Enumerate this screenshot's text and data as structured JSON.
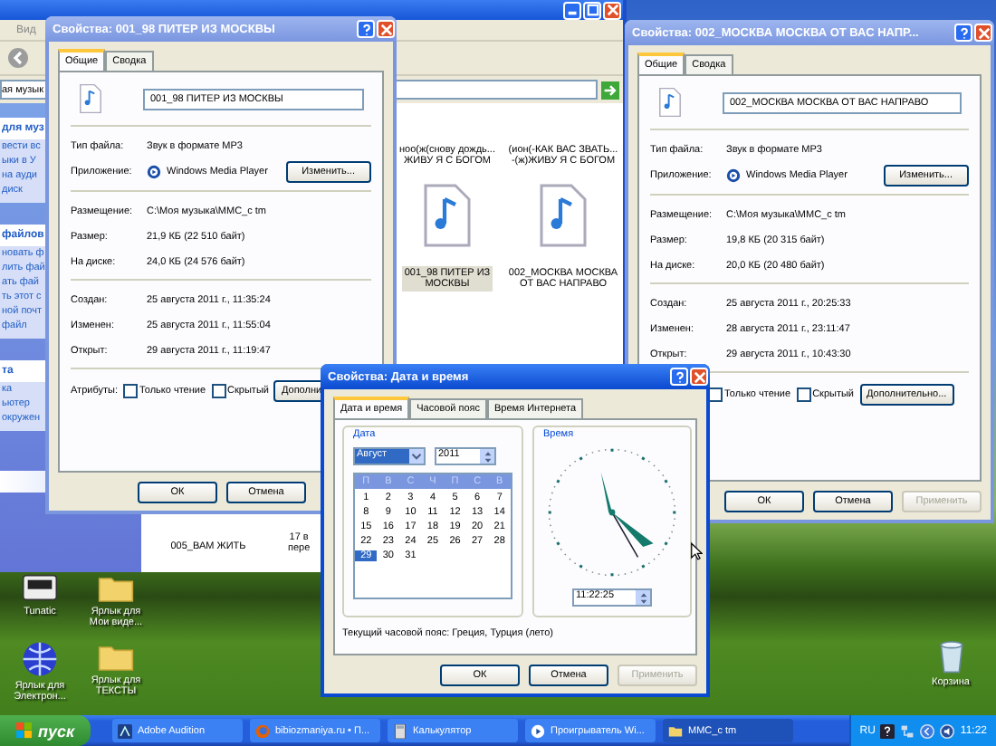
{
  "explorer": {
    "menu": [
      {
        "label": "Вид"
      }
    ],
    "address": "ая музык",
    "sidebar": [
      {
        "title": "для муз",
        "links": [
          "вести вс",
          "ыки в У",
          "на ауди",
          "диск"
        ]
      },
      {
        "title": "файлов",
        "links": [
          "новать ф",
          "лить фай",
          "ать фай",
          "ть этот с",
          "ной почт",
          "файл"
        ]
      },
      {
        "title": "та",
        "links": [
          "ка",
          "ьютер",
          "окружен"
        ]
      }
    ],
    "files": [
      {
        "lines": [
          "ноо(ж(снову дождь...",
          "ЖИВУ Я С БОГОМ"
        ],
        "selected": false
      },
      {
        "lines": [
          "(ион(-КАК ВАС ЗВАТЬ...",
          "-(ж)ЖИВУ Я С БОГОМ"
        ],
        "selected": false
      },
      {
        "lines": [
          "001_98 ПИТЕР ИЗ",
          "МОСКВЫ"
        ],
        "selected": true
      },
      {
        "lines": [
          "002_МОСКВА МОСКВА",
          "ОТ ВАС НАПРАВО"
        ],
        "selected": false
      },
      {
        "lines": [
          "005_ВАМ ЖИТЬ"
        ],
        "selected": false
      },
      {
        "lines": [
          "17 в",
          "пере"
        ],
        "selected": false
      }
    ]
  },
  "desktop_icons": [
    {
      "kind": "app",
      "lines": [
        "Tunatic"
      ]
    },
    {
      "kind": "folder",
      "lines": [
        "Ярлык для",
        "Мои виде..."
      ]
    },
    {
      "kind": "globe",
      "lines": [
        "Ярлык для",
        "Электрон..."
      ]
    },
    {
      "kind": "folder",
      "lines": [
        "Ярлык для",
        "ТЕКСТЫ"
      ]
    },
    {
      "kind": "bin",
      "lines": [
        "Корзина"
      ]
    }
  ],
  "dialogs": [
    {
      "title": "Свойства: 001_98 ПИТЕР ИЗ МОСКВЫ",
      "active": false,
      "tabs": [
        {
          "label": "Общие",
          "selected": true
        },
        {
          "label": "Сводка",
          "selected": false
        }
      ],
      "name": "001_98 ПИТЕР ИЗ МОСКВЫ",
      "sections": [
        [
          {
            "kind": "text",
            "label": "Тип файла:",
            "value": "Звук в формате MP3"
          },
          {
            "kind": "app",
            "label": "Приложение:",
            "value": "Windows Media Player",
            "button": "Изменить..."
          }
        ],
        [
          {
            "kind": "text",
            "label": "Размещение:",
            "value": "C:\\Моя музыка\\MMC_c tm"
          },
          {
            "kind": "text",
            "label": "Размер:",
            "value": "21,9 КБ (22 510 байт)"
          },
          {
            "kind": "text",
            "label": "На диске:",
            "value": "24,0 КБ (24 576 байт)"
          }
        ],
        [
          {
            "kind": "text",
            "label": "Создан:",
            "value": "25 августа 2011 г., 11:35:24"
          },
          {
            "kind": "text",
            "label": "Изменен:",
            "value": "25 августа 2011 г., 11:55:04"
          },
          {
            "kind": "text",
            "label": "Открыт:",
            "value": "29 августа 2011 г., 11:19:47"
          }
        ]
      ],
      "attributes": {
        "label": "Атрибуты:",
        "checkboxes": [
          {
            "label": "Только чтение",
            "checked": false
          },
          {
            "label": "Скрытый",
            "checked": false
          }
        ],
        "button": "Дополни"
      },
      "buttons": [
        {
          "label": "ОК",
          "disabled": false
        },
        {
          "label": "Отмена",
          "disabled": false
        }
      ]
    },
    {
      "title": "Свойства: 002_МОСКВА МОСКВА ОТ ВАС НАПР...",
      "active": false,
      "tabs": [
        {
          "label": "Общие",
          "selected": true
        },
        {
          "label": "Сводка",
          "selected": false
        }
      ],
      "name": "002_МОСКВА МОСКВА ОТ ВАС НАПРАВО",
      "sections": [
        [
          {
            "kind": "text",
            "label": "Тип файла:",
            "value": "Звук в формате MP3"
          },
          {
            "kind": "app",
            "label": "Приложение:",
            "value": "Windows Media Player",
            "button": "Изменить..."
          }
        ],
        [
          {
            "kind": "text",
            "label": "Размещение:",
            "value": "C:\\Моя музыка\\MMC_c tm"
          },
          {
            "kind": "text",
            "label": "Размер:",
            "value": "19,8 КБ (20 315 байт)"
          },
          {
            "kind": "text",
            "label": "На диске:",
            "value": "20,0 КБ (20 480 байт)"
          }
        ],
        [
          {
            "kind": "text",
            "label": "Создан:",
            "value": "25 августа 2011 г., 20:25:33"
          },
          {
            "kind": "text",
            "label": "Изменен:",
            "value": "28 августа 2011 г., 23:11:47"
          },
          {
            "kind": "text",
            "label": "Открыт:",
            "value": "29 августа 2011 г., 10:43:30"
          }
        ]
      ],
      "attributes": {
        "checkboxes": [
          {
            "label": "Только чтение",
            "checked": false
          },
          {
            "label": "Скрытый",
            "checked": false
          }
        ],
        "button": "Дополнительно..."
      },
      "buttons": [
        {
          "label": "ОК",
          "disabled": false
        },
        {
          "label": "Отмена",
          "disabled": false
        },
        {
          "label": "Применить",
          "disabled": true
        }
      ]
    }
  ],
  "date_dialog": {
    "title": "Свойства: Дата и время",
    "active": true,
    "tabs": [
      {
        "label": "Дата и время",
        "selected": true
      },
      {
        "label": "Часовой пояс",
        "selected": false
      },
      {
        "label": "Время Интернета",
        "selected": false
      }
    ],
    "date_group": "Дата",
    "month": "Август",
    "year": "2011",
    "weekdays": [
      "П",
      "В",
      "С",
      "Ч",
      "П",
      "С",
      "В"
    ],
    "days": [
      {
        "label": "1",
        "selected": false
      },
      {
        "label": "2",
        "selected": false
      },
      {
        "label": "3",
        "selected": false
      },
      {
        "label": "4",
        "selected": false
      },
      {
        "label": "5",
        "selected": false
      },
      {
        "label": "6",
        "selected": false
      },
      {
        "label": "7",
        "selected": false
      },
      {
        "label": "8",
        "selected": false
      },
      {
        "label": "9",
        "selected": false
      },
      {
        "label": "10",
        "selected": false
      },
      {
        "label": "11",
        "selected": false
      },
      {
        "label": "12",
        "selected": false
      },
      {
        "label": "13",
        "selected": false
      },
      {
        "label": "14",
        "selected": false
      },
      {
        "label": "15",
        "selected": false
      },
      {
        "label": "16",
        "selected": false
      },
      {
        "label": "17",
        "selected": false
      },
      {
        "label": "18",
        "selected": false
      },
      {
        "label": "19",
        "selected": false
      },
      {
        "label": "20",
        "selected": false
      },
      {
        "label": "21",
        "selected": false
      },
      {
        "label": "22",
        "selected": false
      },
      {
        "label": "23",
        "selected": false
      },
      {
        "label": "24",
        "selected": false
      },
      {
        "label": "25",
        "selected": false
      },
      {
        "label": "26",
        "selected": false
      },
      {
        "label": "27",
        "selected": false
      },
      {
        "label": "28",
        "selected": false
      },
      {
        "label": "29",
        "selected": true
      },
      {
        "label": "30",
        "selected": false
      },
      {
        "label": "31",
        "selected": false
      }
    ],
    "time_group": "Время",
    "time": "11:22:25",
    "timezone": "Текущий часовой пояс: Греция, Турция (лето)",
    "buttons": [
      {
        "label": "ОК",
        "disabled": false
      },
      {
        "label": "Отмена",
        "disabled": false
      },
      {
        "label": "Применить",
        "disabled": true
      }
    ]
  },
  "taskbar": {
    "start": "пуск",
    "items": [
      {
        "label": "Adobe Audition",
        "kind": "audio",
        "selected": false
      },
      {
        "label": "bibiozmaniya.ru • П...",
        "kind": "browser",
        "selected": false
      },
      {
        "label": "Калькулятор",
        "kind": "calc",
        "selected": false
      },
      {
        "label": "Проигрыватель Wi...",
        "kind": "player",
        "selected": false
      },
      {
        "label": "MMC_c tm",
        "kind": "folder",
        "selected": true
      }
    ],
    "language": "RU",
    "clock": "11:22"
  }
}
